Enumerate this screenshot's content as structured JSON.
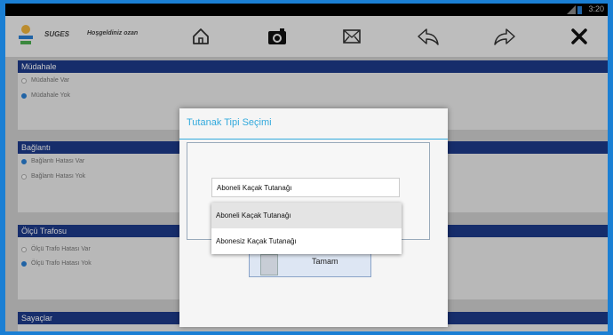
{
  "statusbar": {
    "time": "3:20"
  },
  "toolbar": {
    "app_name": "SUGES",
    "welcome": "Hoşgeldiniz ozan",
    "icons": [
      "home-icon",
      "camera-icon",
      "mail-icon",
      "back-icon",
      "forward-icon",
      "close-icon"
    ]
  },
  "sections": [
    {
      "title": "Müdahale",
      "options": [
        {
          "label": "Müdahale Var",
          "selected": false
        },
        {
          "label": "Müdahale Yok",
          "selected": true
        }
      ]
    },
    {
      "title": "Bağlantı",
      "options": [
        {
          "label": "Bağlantı Hatası Var",
          "selected": true
        },
        {
          "label": "Bağlantı Hatası Yok",
          "selected": false
        }
      ]
    },
    {
      "title": "Ölçü Trafosu",
      "options": [
        {
          "label": "Ölçü Trafo Hatası Var",
          "selected": false
        },
        {
          "label": "Ölçü Trafo Hatası Yok",
          "selected": true
        }
      ]
    },
    {
      "title": "Sayaçlar",
      "options": []
    }
  ],
  "dialog": {
    "title": "Tutanak Tipi Seçimi",
    "selected_value": "Aboneli Kaçak Tutanağı",
    "options": [
      "Aboneli Kaçak Tutanağı",
      "Abonesiz Kaçak Tutanağı"
    ],
    "ok_label": "Tamam"
  },
  "colors": {
    "accent": "#33aadd",
    "section_header": "#1d3a8a",
    "frame": "#1a7fd4"
  }
}
